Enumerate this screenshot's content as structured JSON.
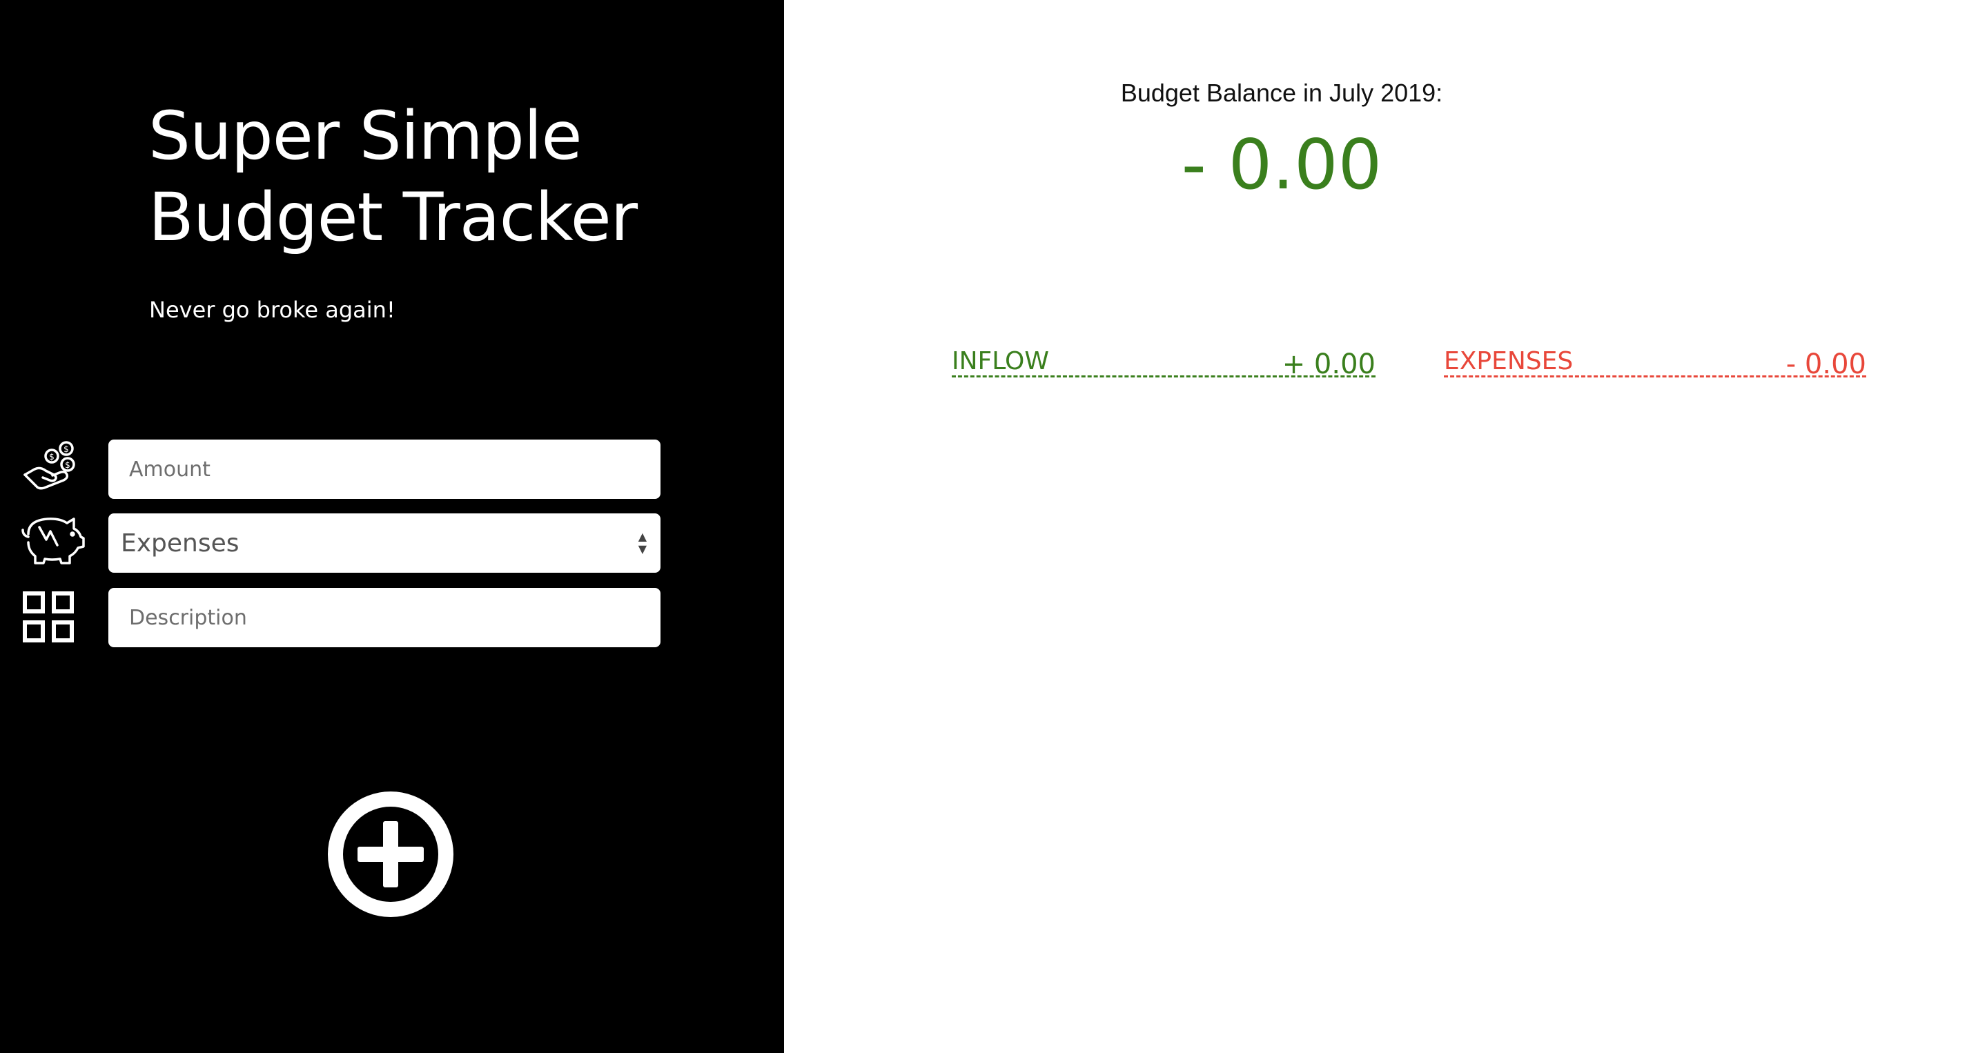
{
  "app": {
    "title_line1": "Super Simple",
    "title_line2": "Budget Tracker",
    "tagline": "Never go broke again!"
  },
  "form": {
    "amount_placeholder": "Amount",
    "amount_value": "",
    "type_selected": "Expenses",
    "description_placeholder": "Description",
    "description_value": ""
  },
  "icons": {
    "amount": "money-hand-icon",
    "type": "piggy-bank-icon",
    "description": "grid-icon",
    "add": "plus-circle-icon"
  },
  "balance": {
    "label": "Budget Balance in July 2019:",
    "value": "- 0.00"
  },
  "summary": {
    "inflow_label": "INFLOW",
    "inflow_value": "+ 0.00",
    "expenses_label": "EXPENSES",
    "expenses_value": "- 0.00"
  },
  "colors": {
    "positive": "#3a7f1d",
    "negative": "#e8473a",
    "sidebar": "#000000"
  }
}
